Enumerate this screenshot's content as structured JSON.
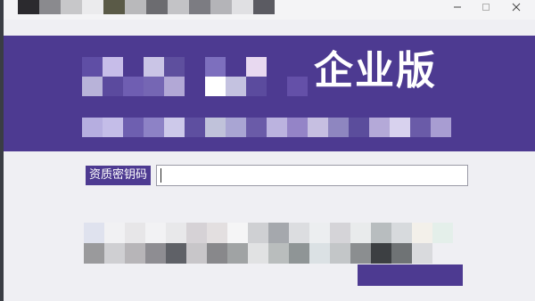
{
  "banner": {
    "edition_title": "企业版"
  },
  "form": {
    "field_label": "资质密钥码",
    "field_value": ""
  },
  "colors": {
    "brand_purple": "#4d3a91",
    "window_bg": "#efeff3",
    "input_border": "#9a9aa6"
  },
  "icons": {
    "minimize": "minimize-icon",
    "maximize": "maximize-icon",
    "close": "close-icon"
  }
}
